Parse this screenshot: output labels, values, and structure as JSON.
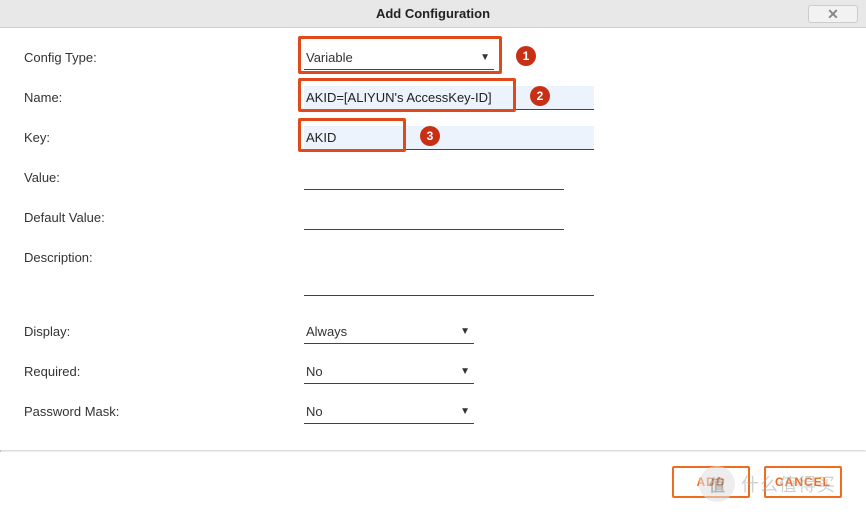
{
  "dialog": {
    "title": "Add Configuration"
  },
  "labels": {
    "config_type": "Config Type:",
    "name": "Name:",
    "key": "Key:",
    "value": "Value:",
    "default_value": "Default Value:",
    "description": "Description:",
    "display": "Display:",
    "required": "Required:",
    "password_mask": "Password Mask:"
  },
  "fields": {
    "config_type": "Variable",
    "name": "AKID=[ALIYUN's AccessKey-ID]",
    "key": "AKID",
    "value": "",
    "default_value": "",
    "description": "",
    "display": "Always",
    "required": "No",
    "password_mask": "No"
  },
  "callouts": {
    "one": "1",
    "two": "2",
    "three": "3"
  },
  "buttons": {
    "add": "ADD",
    "cancel": "CANCEL"
  },
  "watermark": {
    "badge": "值",
    "text": "什么值得买"
  }
}
